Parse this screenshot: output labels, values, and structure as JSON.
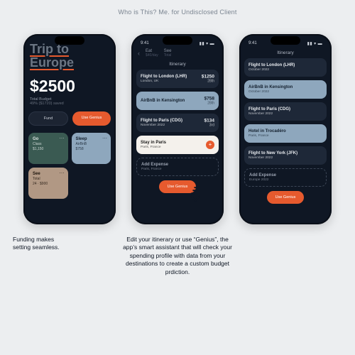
{
  "attribution": "Who is This? Me. for Undisclosed Client",
  "status": {
    "time": "9:41",
    "icons": "▮▮ ▾ ▬"
  },
  "colors": {
    "accent": "#e65a2e",
    "bg_dark": "#0f1724"
  },
  "phone1": {
    "trip_title": "Trip to\nEurope",
    "amount": "$2500",
    "budget_label": "Total Budget",
    "budget_sub": "49% ($1720) saved",
    "cta_fund": "Fund",
    "cta_genius": "Use Genius",
    "categories": [
      {
        "label": "Go",
        "sub1": "Class",
        "sub2": "$1,150",
        "variant": "green"
      },
      {
        "label": "Sleep",
        "sub1": "AirBnB",
        "sub2": "$758",
        "variant": "blue"
      },
      {
        "label": "See",
        "sub1": "Total",
        "sub2": "24 · $900",
        "variant": "brown"
      }
    ]
  },
  "phone2": {
    "breadcrumb": {
      "seg1": {
        "l1": "Eat",
        "l2": "$40/day"
      },
      "seg2": {
        "l1": "See",
        "l2": "Total"
      }
    },
    "header": "Itinerary",
    "items": [
      {
        "variant": "dark",
        "title": "Flight to London (LHR)",
        "sub": "London, UK",
        "price": "$1250",
        "date": "28th",
        "tiny": ""
      },
      {
        "variant": "blue",
        "title": "AirBnB in Kensington",
        "sub": "",
        "price": "$758",
        "date": "28th",
        "tiny": ""
      },
      {
        "variant": "dark",
        "title": "Flight to Paris (CDG)",
        "sub": "November 2022",
        "price": "$134",
        "date": "3rd",
        "tiny": ""
      },
      {
        "variant": "white",
        "title": "Stay in Paris",
        "sub": "Paris, France",
        "price": "",
        "date": "",
        "tiny": "",
        "add": true
      },
      {
        "variant": "ghost",
        "title": "Add Expense",
        "sub": "Paris, France"
      }
    ],
    "cta_genius": "Use Genius"
  },
  "phone3": {
    "header": "Itinerary",
    "items": [
      {
        "variant": "dark",
        "title": "Flight to London (LHR)",
        "sub": "October 2022"
      },
      {
        "variant": "blue",
        "title": "AirBnB in Kensington",
        "sub": "October 2022"
      },
      {
        "variant": "dark",
        "title": "Flight to Paris (CDG)",
        "sub": "November 2022"
      },
      {
        "variant": "blue",
        "title": "Hotel in Trocadéro",
        "sub": "Paris, France"
      },
      {
        "variant": "dark",
        "title": "Flight to New York (JFK)",
        "sub": "November 2022"
      },
      {
        "variant": "ghost",
        "title": "Add Expense",
        "sub": "Europe 2022"
      }
    ],
    "cta_genius": "Use Genius"
  },
  "captions": {
    "c1": "Funding makes \nsetting seamless.",
    "c2": "Edit your itinerary or use “Genius”, the app’s smart assistant that will check your spending profile with data from your destinations to create a custom budget prdiction.",
    "c3": ""
  }
}
